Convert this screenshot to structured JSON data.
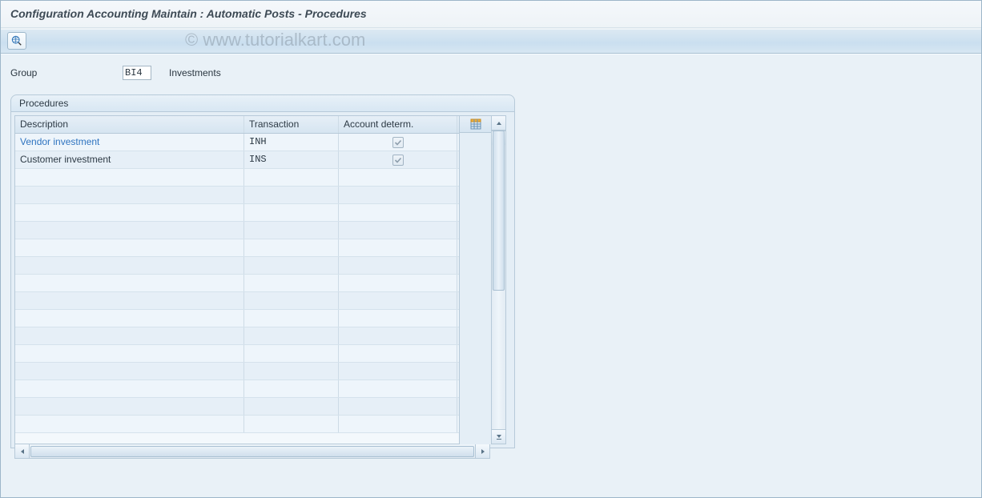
{
  "title": "Configuration Accounting Maintain : Automatic Posts - Procedures",
  "watermark": "© www.tutorialkart.com",
  "toolbar": {
    "overview_tooltip": "Overview"
  },
  "group_field": {
    "label": "Group",
    "value": "BI4",
    "description": "Investments"
  },
  "groupbox": {
    "title": "Procedures",
    "columns": {
      "description": "Description",
      "transaction": "Transaction",
      "account_determ": "Account determ."
    },
    "rows": [
      {
        "description": "Vendor investment",
        "transaction": "INH",
        "account_determ": true,
        "selected": true
      },
      {
        "description": "Customer investment",
        "transaction": "INS",
        "account_determ": true,
        "selected": false
      }
    ],
    "empty_rows": 15,
    "config_button_tooltip": "Configuration"
  }
}
